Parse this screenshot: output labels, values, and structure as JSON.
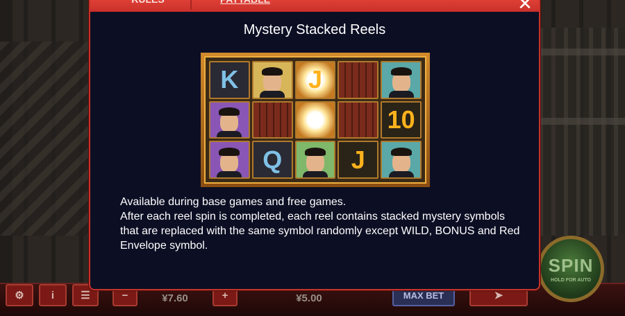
{
  "modal": {
    "tabs": [
      {
        "label": "RULES"
      },
      {
        "label": "PAYTABLE"
      }
    ],
    "close_symbol": "✕",
    "section_title": "Mystery Stacked Reels",
    "description_lines": [
      "Available during base games and free games.",
      "After each reel spin is completed, each reel contains stacked mystery symbols that are replaced with the same symbol randomly except WILD, BONUS and Red Envelope symbol."
    ],
    "reel_symbols": [
      [
        "K",
        "man-gold",
        "J-flash",
        "door",
        "man-teal"
      ],
      [
        "man-purple",
        "K-door",
        "flash",
        "door",
        "10"
      ],
      [
        "man-purple",
        "Q",
        "man-green",
        "J",
        "man-teal"
      ]
    ]
  },
  "controls": {
    "bet_value": "¥7.60",
    "win_value": "¥5.00",
    "max_bet_label": "MAX BET",
    "spin_label": "SPIN",
    "spin_sub_label": "HOLD FOR AUTO",
    "minus_label": "−",
    "plus_label": "+",
    "info_label": "i"
  },
  "colors": {
    "header_red": "#e8473c",
    "panel_bg": "#0c0f24",
    "reel_gold": "#f0b040"
  }
}
